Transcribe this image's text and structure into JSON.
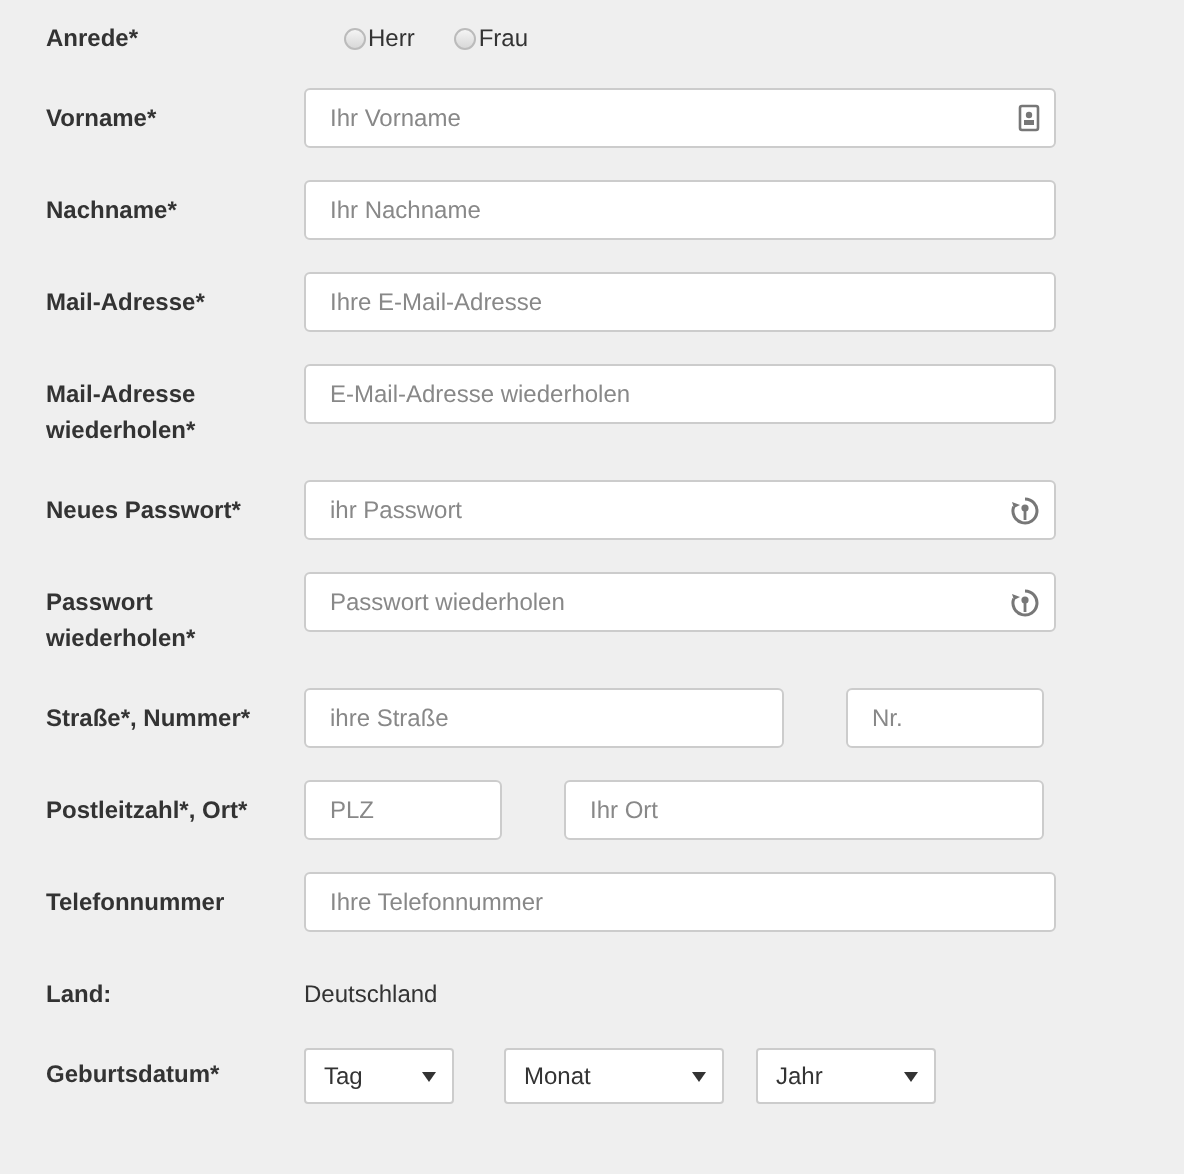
{
  "rows": [
    {
      "kind": "radio",
      "label": "Anrede*",
      "options": [
        {
          "label": "Herr",
          "selected": false
        },
        {
          "label": "Frau",
          "selected": false
        }
      ]
    },
    {
      "kind": "text",
      "label": "Vorname*",
      "fields": [
        {
          "placeholder": "Ihr Vorname",
          "kind": "name"
        }
      ]
    },
    {
      "kind": "text",
      "label": "Nachname*",
      "fields": [
        {
          "placeholder": "Ihr Nachname",
          "kind": "text"
        }
      ]
    },
    {
      "kind": "text",
      "label": "Mail-Adresse*",
      "fields": [
        {
          "placeholder": "Ihre E-Mail-Adresse",
          "kind": "text"
        }
      ]
    },
    {
      "kind": "text",
      "label": "Mail-Adresse wiederholen*",
      "fields": [
        {
          "placeholder": "E-Mail-Adresse wiederholen",
          "kind": "text"
        }
      ]
    },
    {
      "kind": "text",
      "label": "Neues Passwort*",
      "fields": [
        {
          "placeholder": "ihr Passwort",
          "kind": "password"
        }
      ]
    },
    {
      "kind": "text",
      "label": "Passwort wiederholen*",
      "fields": [
        {
          "placeholder": "Passwort wiederholen",
          "kind": "password"
        }
      ]
    },
    {
      "kind": "text",
      "label": "Straße*, Nummer*",
      "fields": [
        {
          "placeholder": "ihre Straße",
          "kind": "street"
        },
        {
          "placeholder": "Nr.",
          "kind": "number"
        }
      ]
    },
    {
      "kind": "text",
      "label": "Postleitzahl*, Ort*",
      "fields": [
        {
          "placeholder": "PLZ",
          "kind": "zip"
        },
        {
          "placeholder": "Ihr Ort",
          "kind": "city"
        }
      ]
    },
    {
      "kind": "text",
      "label": "Telefonnummer",
      "fields": [
        {
          "placeholder": "Ihre Telefonnummer",
          "kind": "text"
        }
      ]
    },
    {
      "kind": "static",
      "label": "Land:",
      "value": "Deutschland"
    },
    {
      "kind": "date",
      "label": "Geburtsdatum*",
      "selects": [
        {
          "value": "Tag"
        },
        {
          "value": "Monat"
        },
        {
          "value": "Jahr"
        }
      ]
    }
  ]
}
